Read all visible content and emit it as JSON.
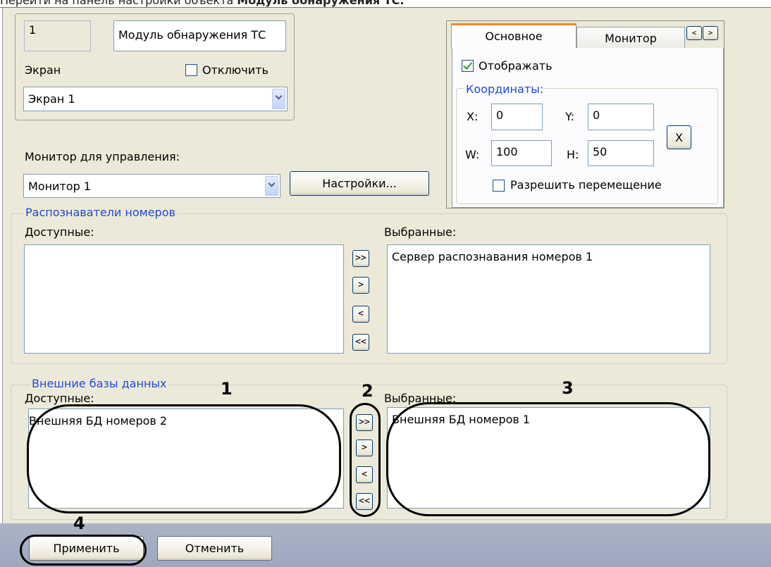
{
  "caption": {
    "prefix": "Перейти на панель настройки объекта ",
    "object_name": "Модуль обнаружения ТС."
  },
  "object": {
    "id": "1",
    "name": "Модуль обнаружения ТС"
  },
  "screen": {
    "label": "Экран",
    "disable_label": "Отключить",
    "disable_checked": false,
    "selected": "Экран 1"
  },
  "control_monitor": {
    "label": "Монитор для управления:",
    "selected": "Монитор 1",
    "settings_button": "Настройки..."
  },
  "tabs": {
    "items": [
      "Основное",
      "Монитор"
    ],
    "active": "Основное",
    "scroll_left": "<",
    "scroll_right": ">",
    "display_label": "Отображать",
    "display_checked": true,
    "coords_group": "Координаты:",
    "x_label": "X:",
    "x_value": "0",
    "y_label": "Y:",
    "y_value": "0",
    "w_label": "W:",
    "w_value": "100",
    "h_label": "H:",
    "h_value": "50",
    "reset_button": "X",
    "allow_move_label": "Разрешить перемещение",
    "allow_move_checked": false
  },
  "recognizers": {
    "group_title": "Распознаватели номеров",
    "available_label": "Доступные:",
    "selected_label": "Выбранные:",
    "available_items": [],
    "selected_items": [
      "Сервер распознавания номеров 1"
    ],
    "move_all_right": ">>",
    "move_right": ">",
    "move_left": "<",
    "move_all_left": "<<"
  },
  "external_db": {
    "group_title": "Внешние базы данных",
    "available_label": "Доступные:",
    "selected_label": "Выбранные:",
    "available_items": [
      "Внешняя БД номеров 2"
    ],
    "selected_items": [
      "Внешняя БД номеров 1"
    ],
    "move_all_right": ">>",
    "move_right": ">",
    "move_left": "<",
    "move_all_left": "<<"
  },
  "footer": {
    "apply": "Применить",
    "cancel": "Отменить"
  },
  "annotations": [
    "1",
    "2",
    "3",
    "4"
  ]
}
